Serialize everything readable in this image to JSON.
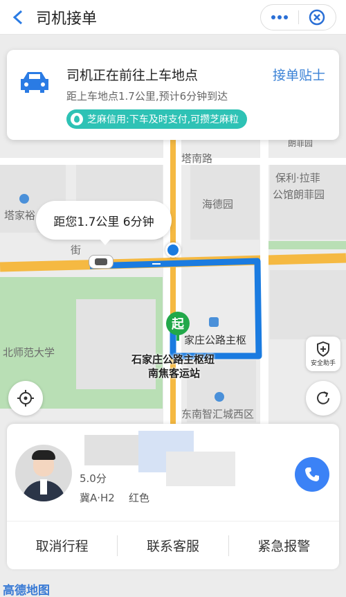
{
  "header": {
    "title": "司机接单",
    "more_icon": "more-dots-icon",
    "close_icon": "close-circle-icon"
  },
  "status_card": {
    "title": "司机正在前往上车地点",
    "link": "接单贴士",
    "subtitle": "距上车地点1.7公里,预计6分钟到达",
    "zhima_badge": "芝麻信用:下车及时支付,可攒芝麻粒",
    "car_icon": "car-icon",
    "accent": "#3b82d6",
    "badge_color": "#2ec2b5"
  },
  "map": {
    "bubble_text": "距您1.7公里 6分钟",
    "start_marker": "起",
    "labels": {
      "tanan_road": "塔南路",
      "haide_garden": "海德园",
      "poly": "保利·拉菲",
      "poly2": "公馆朗菲园",
      "tajia": "塔家裕",
      "beishi": "北师范大学",
      "station_small": "家庄公路主枢",
      "station_main": "石家庄公路主枢纽",
      "station_main2": "南焦客运站",
      "southeast": "东南智汇城西区",
      "langfei_top": "朗菲园",
      "jie": "街"
    },
    "safety_label": "安全助手",
    "route_color": "#1a7be0"
  },
  "driver": {
    "rating": "5.0分",
    "plate": "冀A·H2",
    "car_color": "红色",
    "actions": [
      "取消行程",
      "联系客服",
      "紧急报警"
    ]
  },
  "footer": {
    "logo": "高德地图"
  }
}
